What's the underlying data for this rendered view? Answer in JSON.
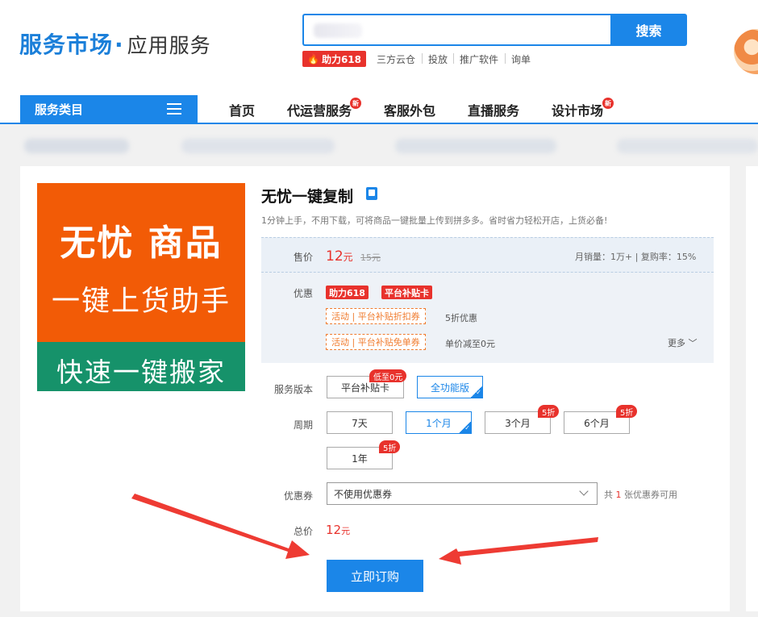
{
  "header": {
    "brand": "服务市场",
    "brand_sub": "应用服务",
    "search_button": "搜索",
    "hot_tag": "助力618",
    "hot_links": [
      "三方云仓",
      "投放",
      "推广软件",
      "询单"
    ]
  },
  "nav": {
    "category": "服务类目",
    "items": [
      {
        "label": "首页",
        "new": false
      },
      {
        "label": "代运营服务",
        "new": true
      },
      {
        "label": "客服外包",
        "new": false
      },
      {
        "label": "直播服务",
        "new": false
      },
      {
        "label": "设计市场",
        "new": true
      }
    ],
    "new_badge": "新"
  },
  "product": {
    "image_lines": [
      "无忧 商品",
      "一键上货助手",
      "快速一键搬家"
    ],
    "title": "无忧一键复制",
    "desc": "1分钟上手，不用下载，可将商品一键批量上传到拼多多。省时省力轻松开店，上货必备!",
    "price_label": "售价",
    "price": "12",
    "price_unit": "元",
    "price_old": "15元",
    "sales": "月销量：1万+ | 复购率：15%",
    "promo_label": "优惠",
    "promo_tags": [
      "助力618",
      "平台补贴卡"
    ],
    "activities": [
      {
        "tag": "活动 | 平台补贴折扣券",
        "text": "5折优惠"
      },
      {
        "tag": "活动 | 平台补贴免单券",
        "text": "单价减至0元"
      }
    ],
    "more": "更多",
    "version_label": "服务版本",
    "versions": [
      {
        "label": "平台补贴卡",
        "badge": "低至0元",
        "selected": false
      },
      {
        "label": "全功能版",
        "badge": "",
        "selected": true
      }
    ],
    "period_label": "周期",
    "periods": [
      {
        "label": "7天",
        "badge": "",
        "selected": false
      },
      {
        "label": "1个月",
        "badge": "",
        "selected": true
      },
      {
        "label": "3个月",
        "badge": "5折",
        "selected": false
      },
      {
        "label": "6个月",
        "badge": "5折",
        "selected": false
      },
      {
        "label": "1年",
        "badge": "5折",
        "selected": false
      }
    ],
    "coupon_label": "优惠券",
    "coupon_value": "不使用优惠券",
    "coupon_note_pre": "共",
    "coupon_note_num": "1",
    "coupon_note_post": "张优惠券可用",
    "total_label": "总价",
    "total": "12",
    "total_unit": "元",
    "order_button": "立即订购"
  },
  "colors": {
    "primary": "#1b86e8",
    "price_red": "#e8322c",
    "image_orange": "#f25b06",
    "image_green": "#16926a",
    "annotation_arrow": "#ee3b33"
  }
}
